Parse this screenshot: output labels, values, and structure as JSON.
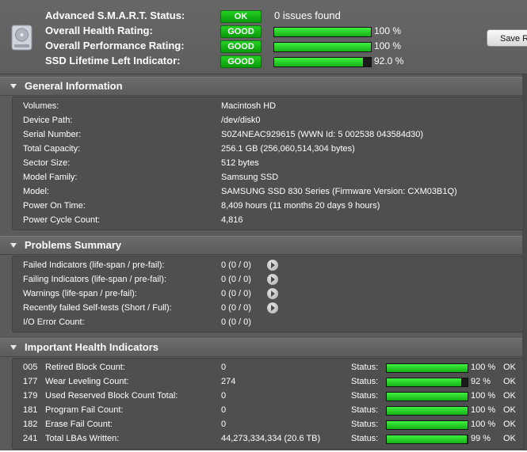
{
  "header": {
    "rows": [
      {
        "label": "Advanced S.M.A.R.T. Status:",
        "badge": "OK",
        "text": "0 issues found"
      },
      {
        "label": "Overall Health Rating:",
        "badge": "GOOD",
        "percent": 100,
        "value": "100 %"
      },
      {
        "label": "Overall Performance Rating:",
        "badge": "GOOD",
        "percent": 100,
        "value": "100 %"
      },
      {
        "label": "SSD Lifetime Left Indicator:",
        "badge": "GOOD",
        "percent": 92,
        "value": "92.0 %"
      }
    ],
    "save_button": "Save R",
    "icon": "hard-disk-icon"
  },
  "general": {
    "title": "General Information",
    "rows": [
      {
        "label": "Volumes:",
        "value": "Macintosh HD"
      },
      {
        "label": "Device Path:",
        "value": "/dev/disk0"
      },
      {
        "label": "Serial Number:",
        "value": "S0Z4NEAC929615 (WWN Id: 5 002538 043584d30)"
      },
      {
        "label": "Total Capacity:",
        "value": "256.1 GB (256,060,514,304 bytes)"
      },
      {
        "label": "Sector Size:",
        "value": "512 bytes"
      },
      {
        "label": "Model Family:",
        "value": "Samsung SSD"
      },
      {
        "label": "Model:",
        "value": "SAMSUNG SSD 830 Series  (Firmware Version: CXM03B1Q)"
      },
      {
        "label": "Power On Time:",
        "value": "8,409 hours (11 months 20 days 9 hours)"
      },
      {
        "label": "Power Cycle Count:",
        "value": "4,816"
      }
    ]
  },
  "problems": {
    "title": "Problems Summary",
    "rows": [
      {
        "label": "Failed Indicators (life-span / pre-fail):",
        "value": "0 (0 / 0)",
        "has_arrow": true
      },
      {
        "label": "Failing Indicators (life-span / pre-fail):",
        "value": "0 (0 / 0)",
        "has_arrow": true
      },
      {
        "label": "Warnings (life-span / pre-fail):",
        "value": "0 (0 / 0)",
        "has_arrow": true
      },
      {
        "label": "Recently failed Self-tests (Short / Full):",
        "value": "0 (0 / 0)",
        "has_arrow": true
      },
      {
        "label": "I/O Error Count:",
        "value": "0 (0 / 0)",
        "has_arrow": false
      }
    ]
  },
  "health": {
    "title": "Important Health Indicators",
    "status_label": "Status:",
    "rows": [
      {
        "id": "005",
        "name": "Retired Block Count:",
        "value": "0",
        "percent": 100,
        "pct_text": "100 %",
        "ok": "OK"
      },
      {
        "id": "177",
        "name": "Wear Leveling Count:",
        "value": "274",
        "percent": 92,
        "pct_text": "92 %",
        "ok": "OK"
      },
      {
        "id": "179",
        "name": "Used Reserved Block Count Total:",
        "value": "0",
        "percent": 100,
        "pct_text": "100 %",
        "ok": "OK"
      },
      {
        "id": "181",
        "name": "Program Fail Count:",
        "value": "0",
        "percent": 100,
        "pct_text": "100 %",
        "ok": "OK"
      },
      {
        "id": "182",
        "name": "Erase Fail Count:",
        "value": "0",
        "percent": 100,
        "pct_text": "100 %",
        "ok": "OK"
      },
      {
        "id": "241",
        "name": "Total LBAs Written:",
        "value": "44,273,334,334 (20.6 TB)",
        "percent": 99,
        "pct_text": "99 %",
        "ok": "OK"
      }
    ]
  }
}
